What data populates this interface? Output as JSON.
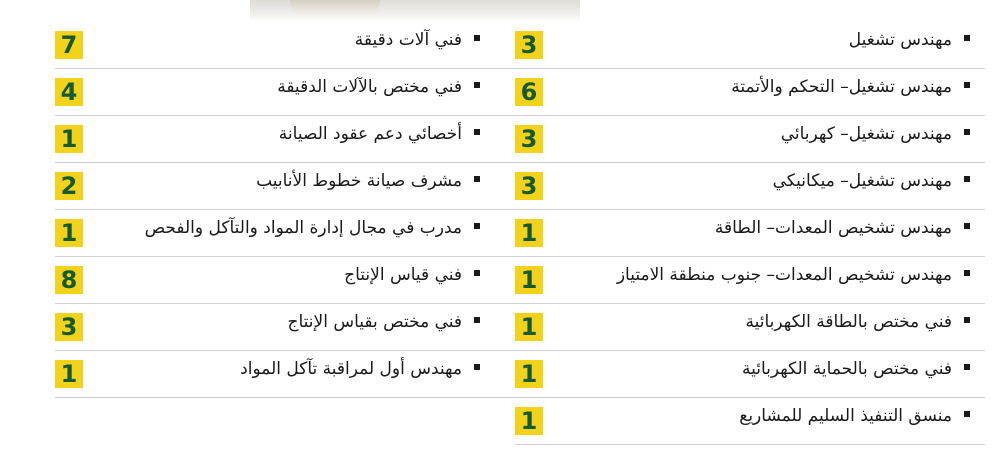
{
  "right_column": [
    {
      "title": "مهندس تشغيل",
      "count": "3"
    },
    {
      "title": "مهندس تشغيل– التحكم والأتمتة",
      "count": "6"
    },
    {
      "title": "مهندس تشغيل– كهربائي",
      "count": "3"
    },
    {
      "title": "مهندس تشغيل– ميكانيكي",
      "count": "3"
    },
    {
      "title": "مهندس تشخيص المعدات– الطاقة",
      "count": "1"
    },
    {
      "title": "مهندس تشخيص المعدات– جنوب منطقة الامتياز",
      "count": "1"
    },
    {
      "title": "فني مختص بالطاقة الكهربائية",
      "count": "1"
    },
    {
      "title": "فني مختص بالحماية الكهربائية",
      "count": "1"
    },
    {
      "title": "منسق التنفيذ السليم للمشاريع",
      "count": "1"
    }
  ],
  "left_column": [
    {
      "title": "فني آلات دقيقة",
      "count": "7"
    },
    {
      "title": "فني مختص بالآلات الدقيقة",
      "count": "4"
    },
    {
      "title": "أخصائي دعم عقود الصيانة",
      "count": "1"
    },
    {
      "title": "مشرف صيانة خطوط الأنابيب",
      "count": "2"
    },
    {
      "title": "مدرب في مجال إدارة المواد والتآكل والفحص",
      "count": "1"
    },
    {
      "title": "فني قياس الإنتاج",
      "count": "8"
    },
    {
      "title": "فني مختص بقياس الإنتاج",
      "count": "3"
    },
    {
      "title": "مهندس أول لمراقبة تآكل المواد",
      "count": "1"
    }
  ],
  "colors": {
    "badge_bg": "#f2d21a",
    "badge_text": "#145a32",
    "divider": "#cfcfcf"
  }
}
